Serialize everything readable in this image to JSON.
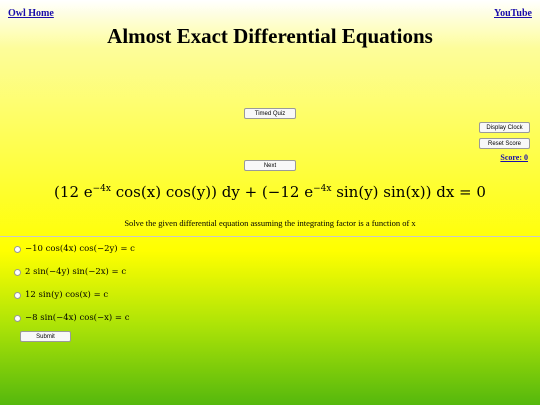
{
  "nav": {
    "home": "Owl Home",
    "youtube": "YouTube"
  },
  "title": "Almost Exact Differential Equations",
  "buttons": {
    "timed_quiz": "Timed Quiz",
    "display_clock": "Display Clock",
    "reset_score": "Reset Score",
    "next": "Next",
    "submit": "Submit"
  },
  "score": "Score: 0",
  "equation": {
    "part1": "(12 e",
    "exp1": "−4x",
    "part2": " cos(x) cos(y)) dy + (−12 e",
    "exp2": "−4x",
    "part3": " sin(y) sin(x)) dx = 0"
  },
  "instructions": "Solve the given differential equation assuming the integrating factor is a function of x",
  "options": [
    "−10 cos(4x) cos(−2y) = c",
    "2 sin(−4y) sin(−2x) = c",
    "12 sin(y) cos(x) = c",
    "−8 sin(−4x) cos(−x) = c"
  ],
  "colors": {
    "link": "#1a0dab",
    "bg_top": "#ffffff",
    "bg_mid": "#ffff00",
    "bg_bottom": "#55b80d"
  }
}
